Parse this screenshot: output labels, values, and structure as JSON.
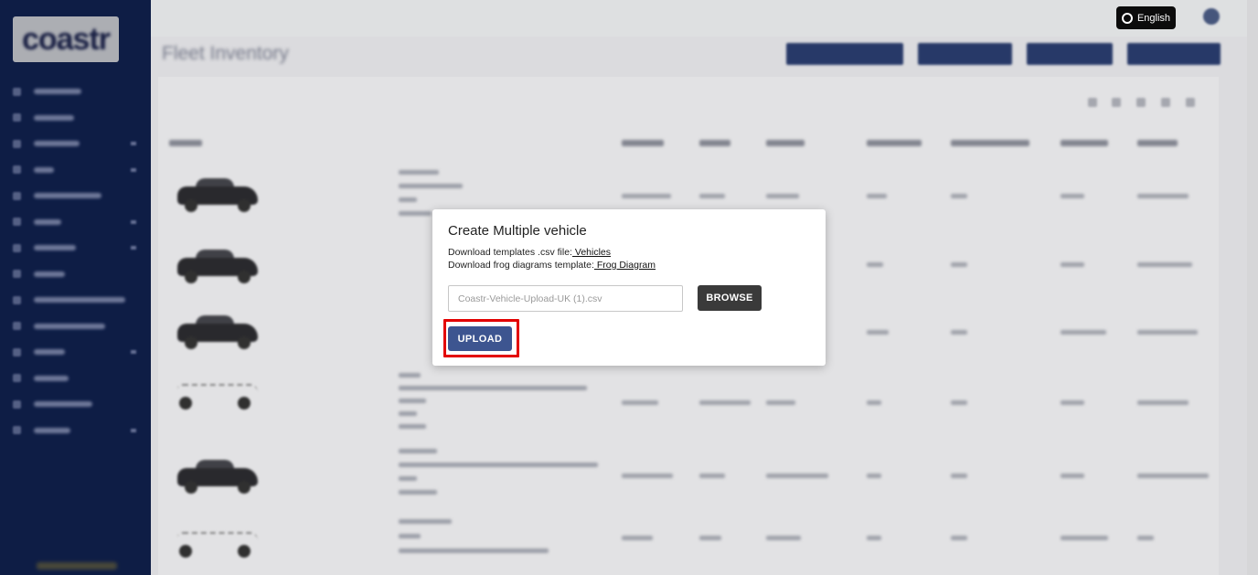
{
  "app": {
    "logo_text": "coastr",
    "language_label": "English"
  },
  "page": {
    "title": "Fleet Inventory"
  },
  "modal": {
    "title": "Create Multiple vehicle",
    "templates_prefix": "Download templates .csv file:",
    "templates_link": " Vehicles",
    "frog_prefix": "Download frog diagrams template:",
    "frog_link": " Frog Diagram",
    "file_placeholder": "Coastr-Vehicle-Upload-UK (1).csv",
    "browse_label": "BROWSE",
    "upload_label": "UPLOAD"
  },
  "colors": {
    "sidebar": "#0f1f4a",
    "upload_button": "#3d5590",
    "browse_button": "#3a3a3a",
    "highlight": "#e30000"
  },
  "icons": {
    "language": "circle-icon"
  }
}
